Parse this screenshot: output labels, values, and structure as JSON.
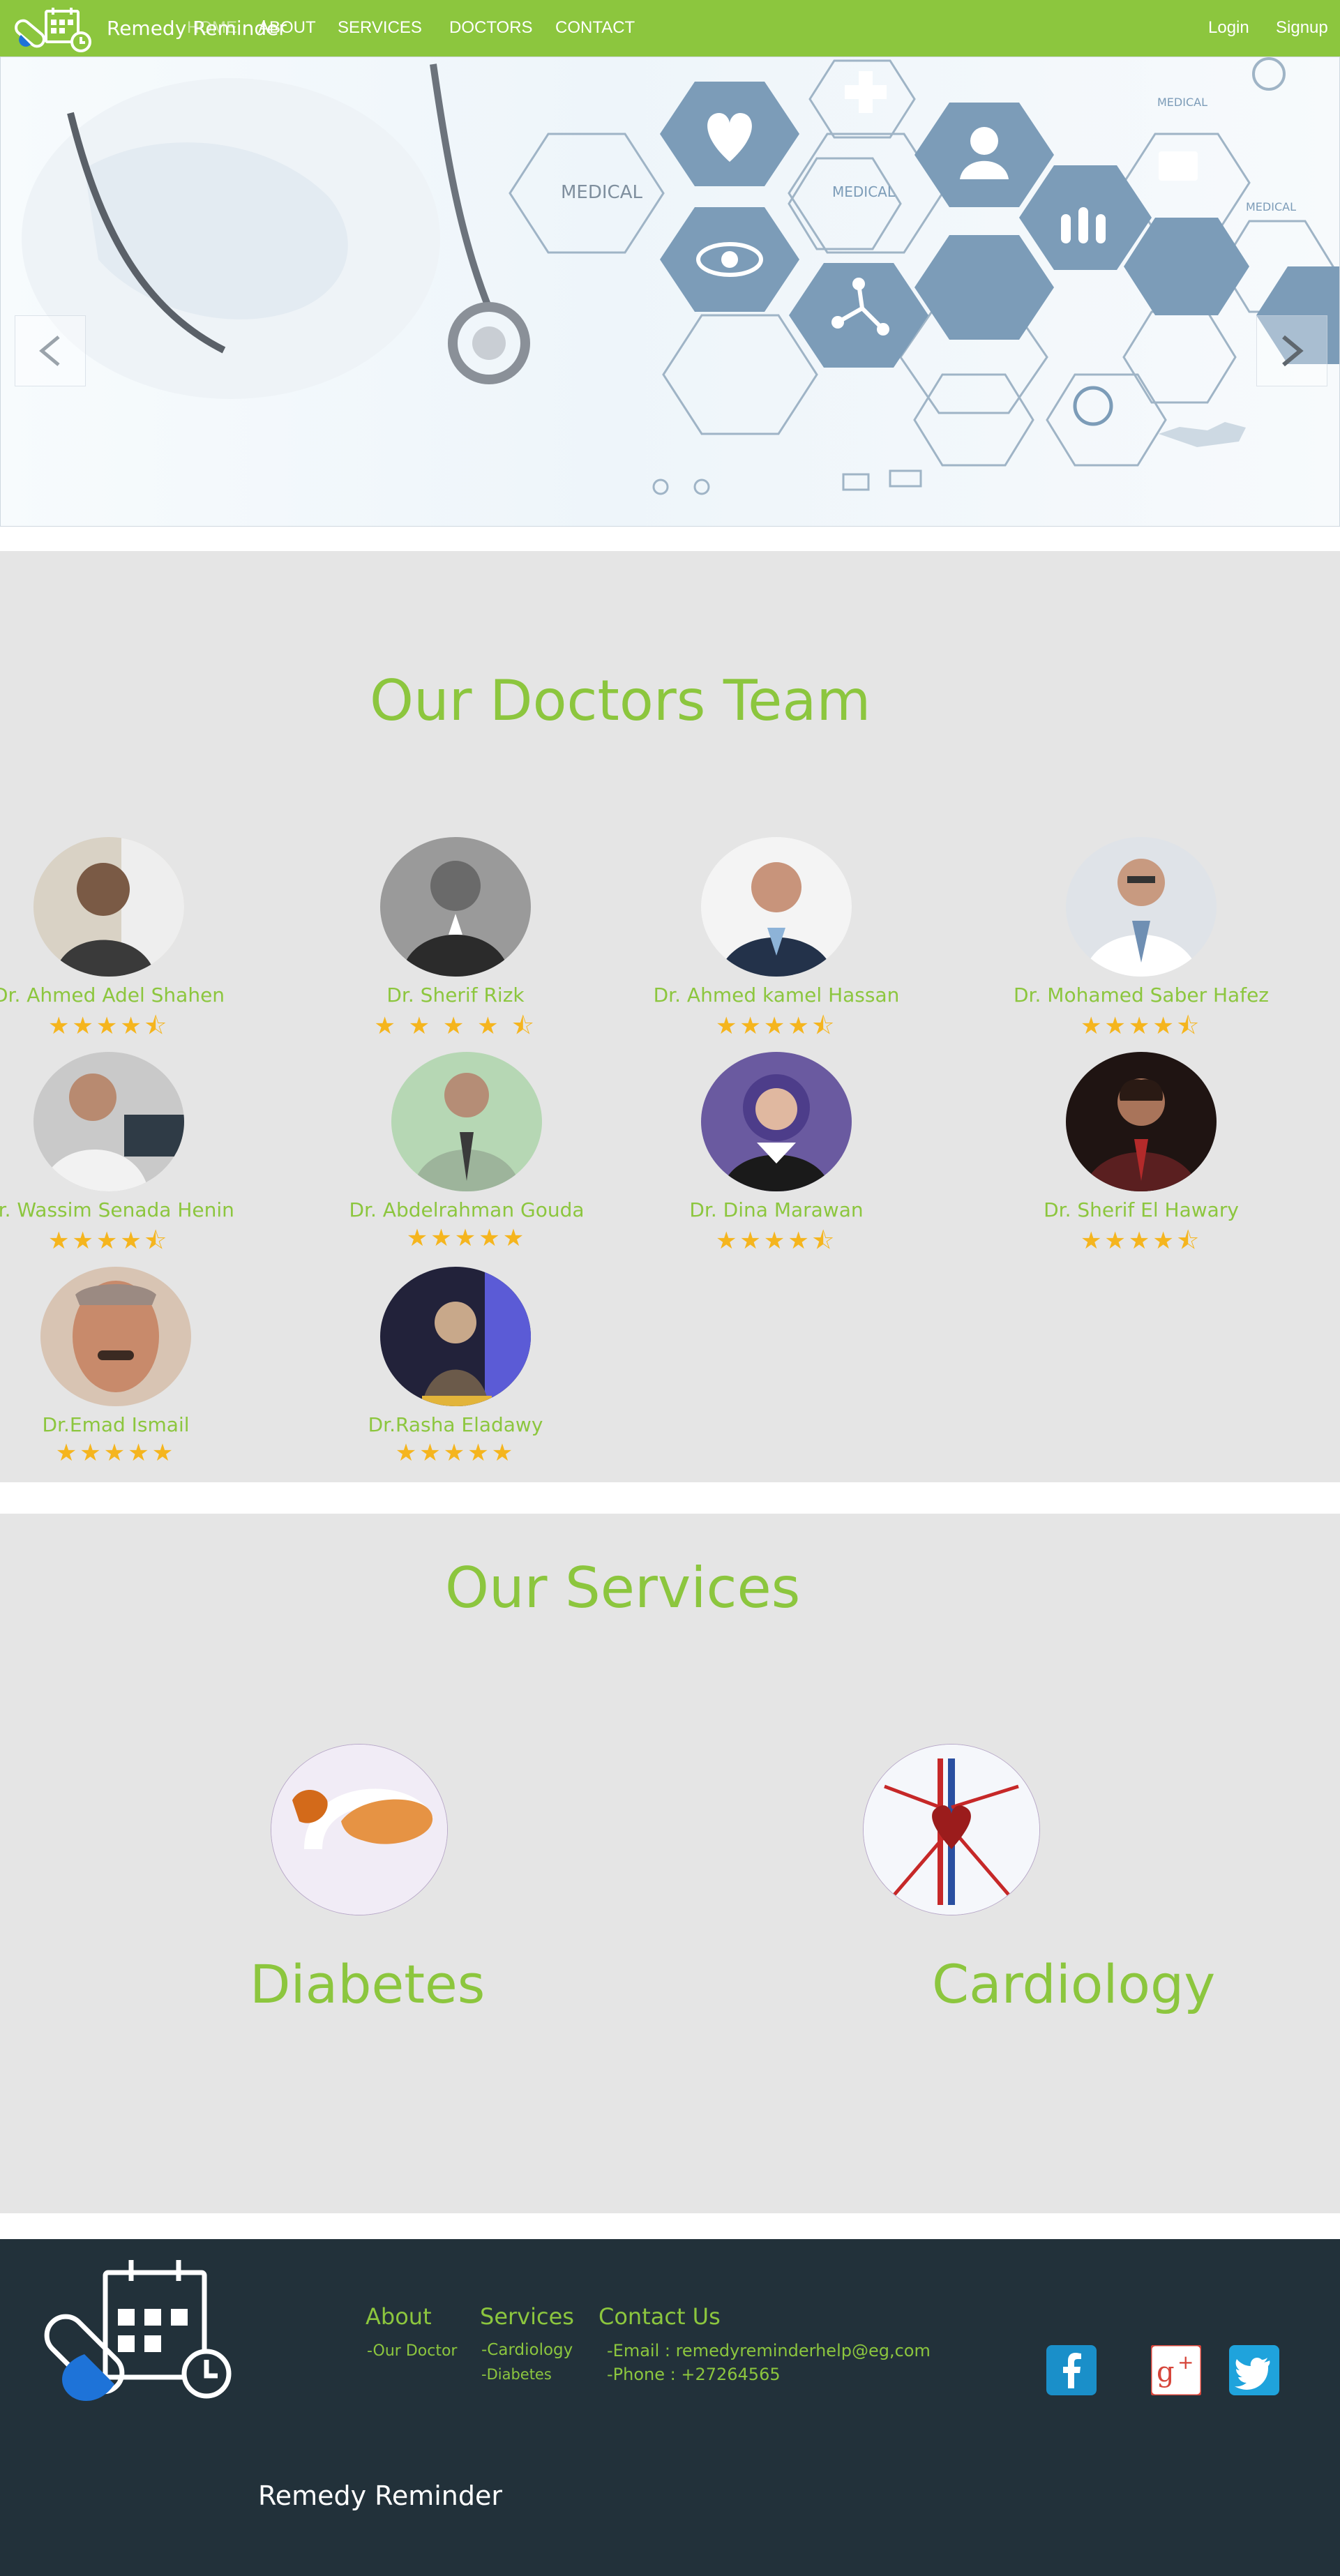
{
  "nav": {
    "brand": "Remedy Reminder",
    "items": [
      "HOME",
      "ABOUT",
      "SERVICES",
      "DOCTORS",
      "CONTACT"
    ],
    "login": "Login",
    "signup": "Signup"
  },
  "hero": {
    "labels": [
      "MEDICAL",
      "MEDICAL",
      "MEDICAL",
      "MEDICAL"
    ]
  },
  "doctors": {
    "title": "Our Doctors Team",
    "list": [
      {
        "name": "Dr. Ahmed Adel Shahen",
        "rating": 4.5
      },
      {
        "name": "Dr. Sherif Rizk",
        "rating": 4.5
      },
      {
        "name": "Dr. Ahmed kamel Hassan",
        "rating": 4.5
      },
      {
        "name": "Dr. Mohamed Saber Hafez",
        "rating": 4.5
      },
      {
        "name": "Dr. Wassim Senada Henin",
        "rating": 4.5
      },
      {
        "name": "Dr. Abdelrahman Gouda",
        "rating": 5
      },
      {
        "name": "Dr. Dina Marawan",
        "rating": 4.5
      },
      {
        "name": "Dr. Sherif El Hawary",
        "rating": 4.5
      },
      {
        "name": "Dr.Emad Ismail",
        "rating": 5
      },
      {
        "name": "Dr.Rasha Eladawy",
        "rating": 5
      }
    ]
  },
  "services": {
    "title": "Our Services",
    "items": [
      {
        "name": "Diabetes"
      },
      {
        "name": "Cardiology"
      }
    ]
  },
  "footer": {
    "brand": "Remedy Reminder",
    "about": {
      "heading": "About",
      "links": [
        "-Our Doctor"
      ]
    },
    "services": {
      "heading": "Services",
      "links": [
        "-Cardiology",
        "-Diabetes"
      ]
    },
    "contact": {
      "heading": "Contact Us",
      "email": "-Email : remedyreminderhelp@eg,com",
      "phone": "-Phone : +27264565"
    },
    "social": [
      "facebook-icon",
      "google-plus-icon",
      "twitter-icon"
    ]
  },
  "colors": {
    "accent": "#8cc63e",
    "footer_bg": "#22313a",
    "section_bg": "#e5e5e5",
    "star": "#f5b51e"
  }
}
